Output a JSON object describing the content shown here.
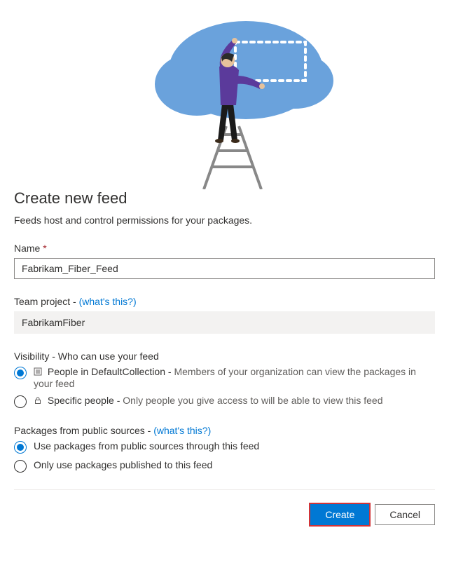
{
  "heading": "Create new feed",
  "subtitle": "Feeds host and control permissions for your packages.",
  "name": {
    "label": "Name",
    "required_marker": "*",
    "value": "Fabrikam_Fiber_Feed"
  },
  "team_project": {
    "label": "Team project - ",
    "link": "(what's this?)",
    "value": "FabrikamFiber"
  },
  "visibility": {
    "label": "Visibility - Who can use your feed",
    "options": [
      {
        "label": "People in DefaultCollection - ",
        "hint": "Members of your organization can view the packages in your feed",
        "checked": true
      },
      {
        "label": "Specific people - ",
        "hint": "Only people you give access to will be able to view this feed",
        "checked": false
      }
    ]
  },
  "public_sources": {
    "label": "Packages from public sources - ",
    "link": "(what's this?)",
    "options": [
      {
        "label": "Use packages from public sources through this feed",
        "checked": true
      },
      {
        "label": "Only use packages published to this feed",
        "checked": false
      }
    ]
  },
  "buttons": {
    "create": "Create",
    "cancel": "Cancel"
  }
}
